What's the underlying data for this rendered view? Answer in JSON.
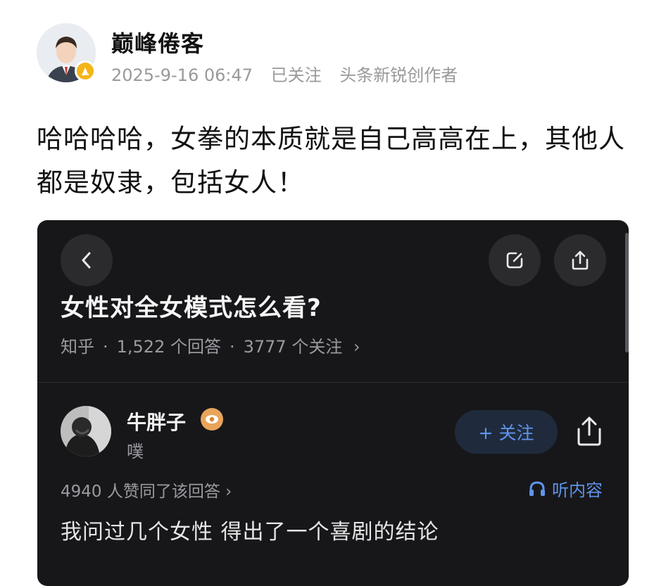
{
  "post": {
    "author": "巅峰倦客",
    "timestamp": "2025-9-16 06:47",
    "follow_status": "已关注",
    "author_tag": "头条新锐创作者",
    "text": "哈哈哈哈，女拳的本质就是自己高高在上，其他人都是奴隶，包括女人！",
    "avatar_icon": "man-in-suit-avatar",
    "badge_icon": "creator-badge-icon"
  },
  "screenshot": {
    "question_title": "女性对全女模式怎么看?",
    "platform": "知乎",
    "answers_count": "1,522 个回答",
    "followers_count": "3777 个关注",
    "meta_chevron": "›",
    "answerer": {
      "name": "牛胖子",
      "subtitle": "噗",
      "follow_button": "+ 关注"
    },
    "upvotes_text": "4940 人赞同了该回答 ›",
    "listen_label": "听内容",
    "answer_text": "我问过几个女性 得出了一个喜剧的结论",
    "colors": {
      "background": "#17171a",
      "accent": "#5f94ea",
      "follow_button_bg": "#1f2b3d"
    },
    "icons": [
      "back-chevron-icon",
      "edit-icon",
      "share-icon",
      "eye-badge-icon",
      "headphone-icon"
    ]
  }
}
